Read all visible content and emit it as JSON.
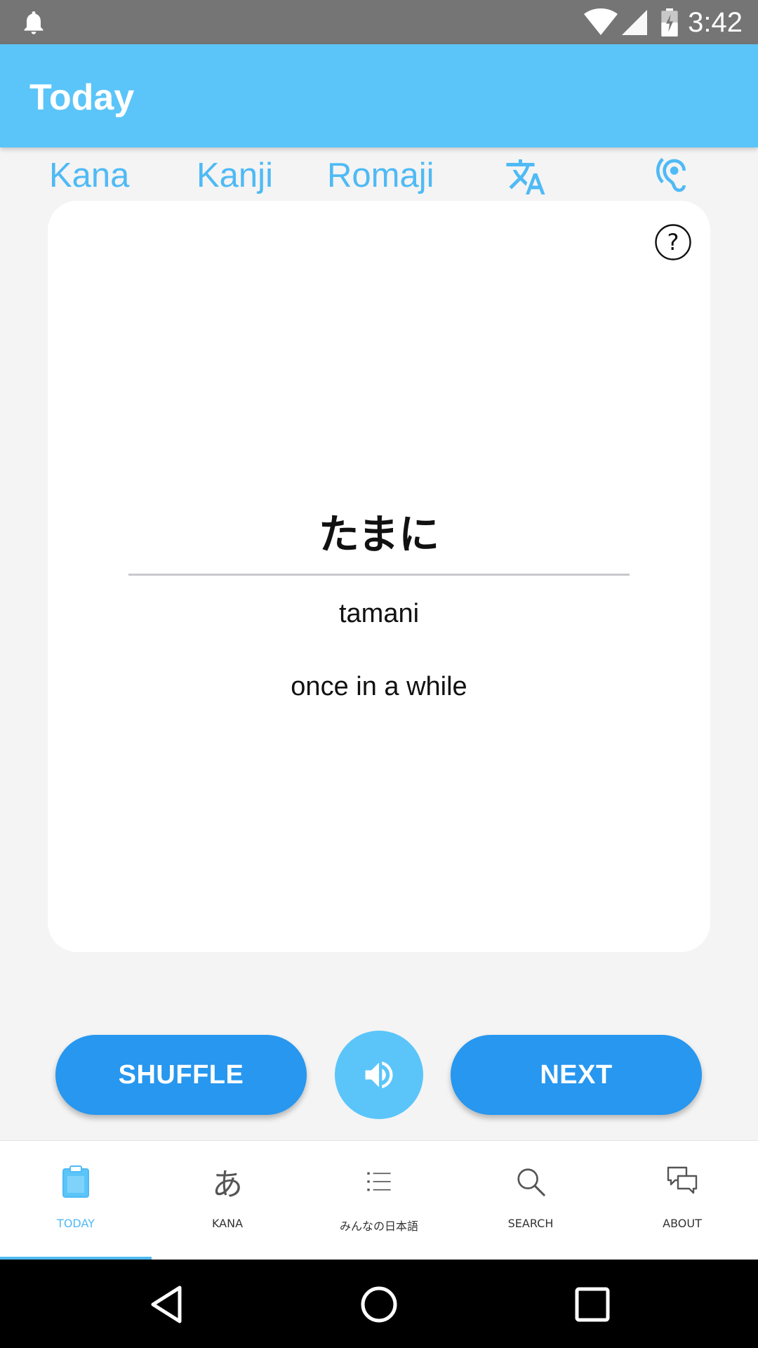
{
  "status_bar": {
    "time": "3:42",
    "icons": [
      "bell-icon",
      "wifi-icon",
      "signal-icon",
      "battery-charging-icon"
    ]
  },
  "app_bar": {
    "title": "Today"
  },
  "modes": {
    "kana": "Kana",
    "kanji": "Kanji",
    "romaji": "Romaji",
    "translate_icon": "translate-icon",
    "listen_icon": "hearing-icon"
  },
  "card": {
    "help_icon": "help-circle-icon",
    "word": "たまに",
    "reading": "tamani",
    "meaning": "once in a while"
  },
  "actions": {
    "shuffle_label": "SHUFFLE",
    "sound_icon": "speaker-icon",
    "next_label": "NEXT"
  },
  "bottom_nav": {
    "items": [
      {
        "label": "TODAY",
        "icon": "clipboard-icon",
        "active": true
      },
      {
        "label": "KANA",
        "icon": "あ",
        "active": false
      },
      {
        "label": "みんなの日本語",
        "icon": "list-icon",
        "active": false
      },
      {
        "label": "SEARCH",
        "icon": "search-icon",
        "active": false
      },
      {
        "label": "ABOUT",
        "icon": "chat-icon",
        "active": false
      }
    ]
  },
  "colors": {
    "app_bar": "#5bc5f9",
    "accent": "#4fbaf5",
    "button": "#2797ef",
    "status_bar": "#757575"
  }
}
